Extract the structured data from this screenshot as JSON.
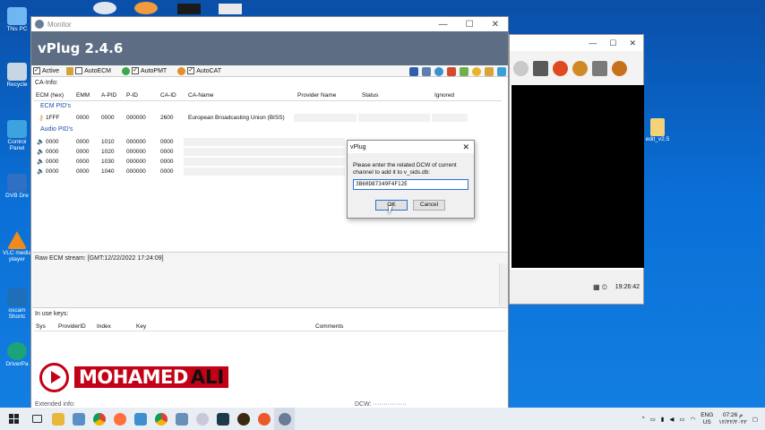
{
  "desktop": {
    "icons": [
      "This PC",
      "Recycle",
      "Control Panel",
      "DVB Dre",
      "VLC media player",
      "oscam Shortc",
      "DriverPa"
    ],
    "file_label": "edit_v2.5"
  },
  "main_window": {
    "title": "Monitor",
    "banner": "vPlug 2.4.6",
    "controls": {
      "minimize": "—",
      "maximize": "☐",
      "close": "✕"
    },
    "toolbar": [
      {
        "label": "Active",
        "checked": true
      },
      {
        "label": "AutoECM",
        "checked": false
      },
      {
        "label": "AutoPMT",
        "checked": true
      },
      {
        "label": "AutoCAT",
        "checked": true
      }
    ],
    "ca_info_label": "CA-Info:",
    "headers": [
      "ECM (hex)",
      "EMM",
      "A-PID",
      "P-ID",
      "CA-ID",
      "CA-Name",
      "Provider Name",
      "Status",
      "Ignored"
    ],
    "ecm_group": "ECM PID's",
    "ecm_row": [
      "1FFF",
      "0000",
      "0000",
      "000000",
      "2600",
      "European Broadcasting Union (BISS)"
    ],
    "audio_group": "Audio PID's",
    "audio_rows": [
      [
        "0000",
        "0000",
        "1010",
        "000000",
        "0000"
      ],
      [
        "0000",
        "0000",
        "1020",
        "000000",
        "0000"
      ],
      [
        "0000",
        "0000",
        "1030",
        "000000",
        "0000"
      ],
      [
        "0000",
        "0000",
        "1040",
        "000000",
        "0000"
      ]
    ],
    "raw_ecm_label": "Raw ECM stream: [GMT:12/22/2022 17:24:09]",
    "inuse_label": "In use keys:",
    "keys_headers": [
      "Sys",
      "ProviderID",
      "Index",
      "Key",
      "Comments"
    ],
    "bottom_left": "Extended info:",
    "bottom_mid": "DCW: ················"
  },
  "dialog": {
    "title": "vPlug",
    "close": "✕",
    "message": "Please enter the related DCW of current channel to add it to v_sids.db:",
    "input_value": "3B60D87349F4F12E",
    "ok_label": "OK",
    "cancel_label": "Cancel"
  },
  "player": {
    "controls": {
      "minimize": "—",
      "maximize": "☐",
      "close": "✕"
    },
    "time": "19:26:42"
  },
  "watermark": {
    "first": "MOHAMED",
    "last": "ALI"
  },
  "taskbar": {
    "lang": "ENG",
    "region": "US",
    "clock_time": "07:26 م",
    "clock_date": "١٢/٢٢/٢٠٢٢"
  },
  "colors": {
    "banner": "#5d6e84",
    "watermark_red": "#c40016",
    "desktop": "#0a6fd6"
  }
}
